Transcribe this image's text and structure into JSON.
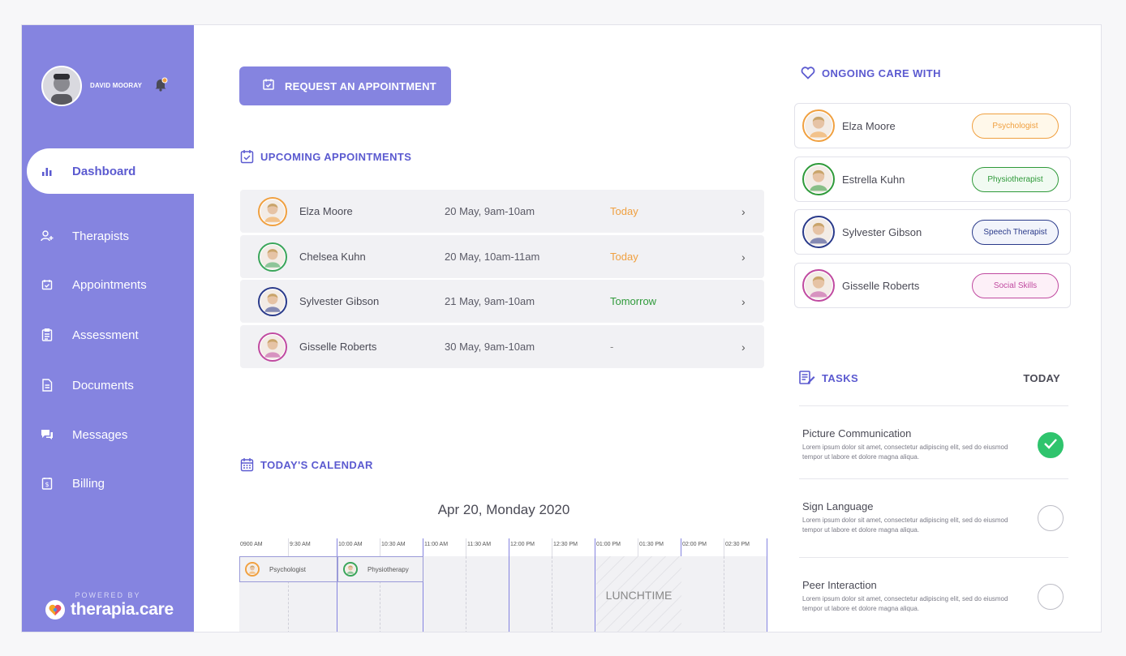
{
  "user": {
    "name": "DAVID MOORAY",
    "notification_icon": "bell-icon"
  },
  "brand": {
    "powered_by": "POWERED BY",
    "name": "therapia.care"
  },
  "nav": [
    {
      "label": "Dashboard",
      "icon": "bar-chart-icon",
      "active": true
    },
    {
      "label": "Therapists",
      "icon": "add-user-icon"
    },
    {
      "label": "Appointments",
      "icon": "calendar-check-icon"
    },
    {
      "label": "Assessment",
      "icon": "clipboard-icon"
    },
    {
      "label": "Documents",
      "icon": "document-icon"
    },
    {
      "label": "Messages",
      "icon": "chat-icon"
    },
    {
      "label": "Billing",
      "icon": "billing-icon"
    }
  ],
  "request_button": {
    "label": "REQUEST AN APPOINTMENT"
  },
  "upcoming": {
    "title": "UPCOMING APPOINTMENTS",
    "items": [
      {
        "name": "Elza Moore",
        "time": "20 May, 9am-10am",
        "when": "Today",
        "when_color": "#f0a040",
        "ring": "#f0a040"
      },
      {
        "name": "Chelsea Kuhn",
        "time": "20 May, 10am-11am",
        "when": "Today",
        "when_color": "#f0a040",
        "ring": "#3aa55a"
      },
      {
        "name": "Sylvester Gibson",
        "time": "21 May, 9am-10am",
        "when": "Tomorrow",
        "when_color": "#2f9a3a",
        "ring": "#2a3a8a"
      },
      {
        "name": "Gisselle Roberts",
        "time": "30 May, 9am-10am",
        "when": "-",
        "when_color": "#888888",
        "ring": "#c04aa0"
      }
    ]
  },
  "calendar": {
    "title": "TODAY'S CALENDAR",
    "date": "Apr 20, Monday 2020",
    "times": [
      "0900 AM",
      "9:30 AM",
      "10:00 AM",
      "10:30 AM",
      "11:00 AM",
      "11:30 AM",
      "12:00 PM",
      "12:30 PM",
      "01:00 PM",
      "01:30 PM",
      "02:00 PM",
      "02:30 PM"
    ],
    "events": [
      {
        "label": "Psychologist",
        "ring": "#f0a040"
      },
      {
        "label": "Physiotherapy",
        "ring": "#3aa55a"
      }
    ],
    "lunch_line1": "LUNCH",
    "lunch_line2": "TIME"
  },
  "care": {
    "title": "ONGOING CARE WITH",
    "items": [
      {
        "name": "Elza Moore",
        "role": "Psychologist",
        "color": "#f0a040",
        "bg": "#fff8ea"
      },
      {
        "name": "Estrella Kuhn",
        "role": "Physiotherapist",
        "color": "#2f9a3a",
        "bg": "#f1faf2"
      },
      {
        "name": "Sylvester Gibson",
        "role": "Speech Therapist",
        "color": "#2a3a8a",
        "bg": "#f2f4fb"
      },
      {
        "name": "Gisselle Roberts",
        "role": "Social Skills",
        "color": "#c04aa0",
        "bg": "#fdf0f8"
      }
    ]
  },
  "tasks": {
    "title": "TASKS",
    "period": "TODAY",
    "items": [
      {
        "title": "Picture Communication",
        "desc": "Lorem ipsum dolor sit amet, consectetur adipiscing elit, sed do eiusmod tempor ut labore et dolore magna aliqua.",
        "done": true
      },
      {
        "title": "Sign Language",
        "desc": "Lorem ipsum dolor sit amet, consectetur adipiscing elit, sed do eiusmod tempor ut labore et dolore magna aliqua.",
        "done": false
      },
      {
        "title": "Peer Interaction",
        "desc": "Lorem ipsum dolor sit amet, consectetur adipiscing elit, sed do eiusmod tempor ut labore et dolore magna aliqua.",
        "done": false
      }
    ]
  }
}
